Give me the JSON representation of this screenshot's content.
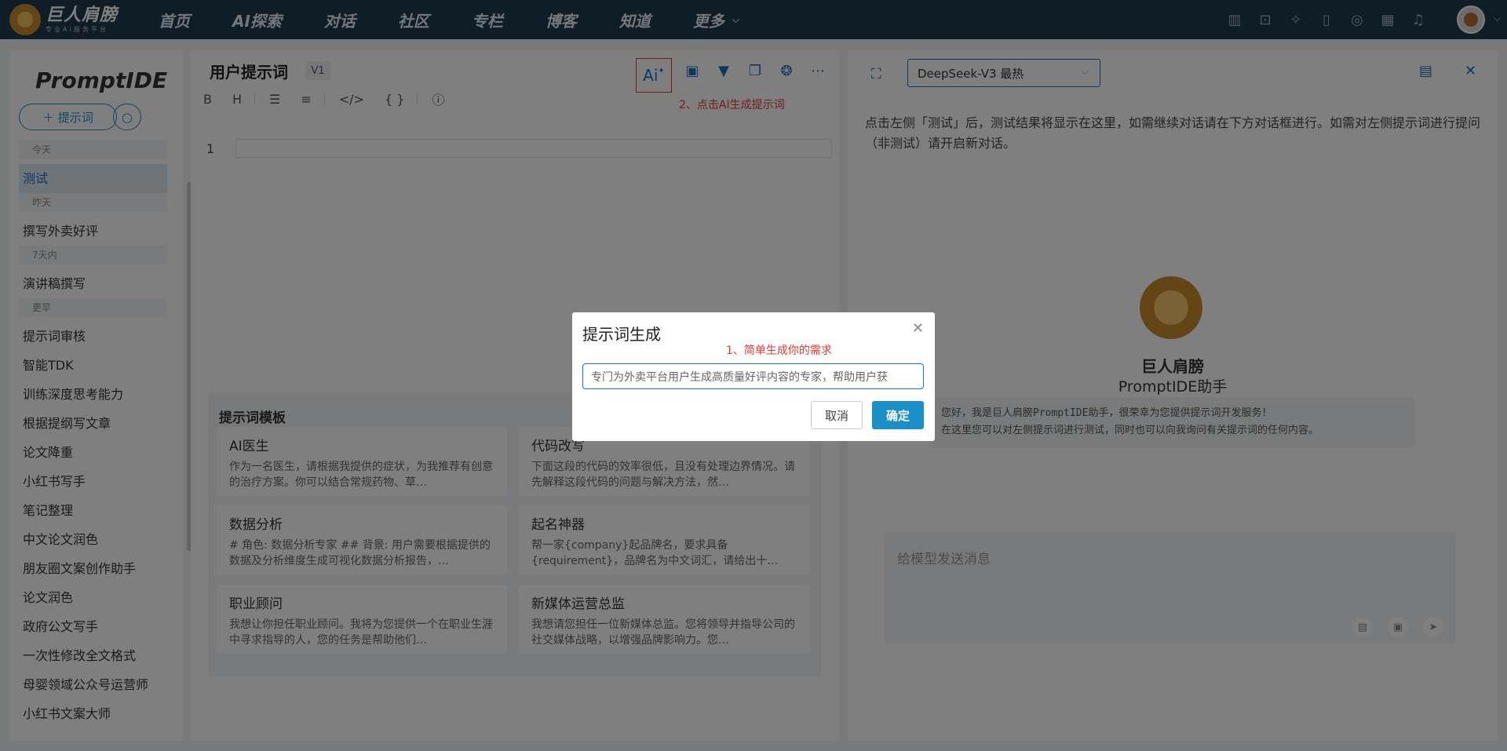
{
  "nav": {
    "logo_name": "巨人肩膀",
    "logo_sub": "专业AI服务平台",
    "items": [
      "首页",
      "AI探索",
      "对话",
      "社区",
      "专栏",
      "博客",
      "知道",
      "更多"
    ],
    "icons": [
      "chart-icon",
      "robot-icon",
      "magic-wand-icon",
      "book-icon",
      "disc-icon",
      "calendar-icon",
      "bell-icon"
    ]
  },
  "sidebar": {
    "brand": "PromptIDE",
    "new_prompt_label": "提示词",
    "groups": [
      {
        "label": "今天",
        "items": [
          "测试"
        ]
      },
      {
        "label": "昨天",
        "items": [
          "撰写外卖好评"
        ]
      },
      {
        "label": "7天内",
        "items": [
          "演讲稿撰写"
        ]
      },
      {
        "label": "更早",
        "items": [
          "提示词审核",
          "智能TDK",
          "训练深度思考能力",
          "根据提纲写文章",
          "论文降重",
          "小红书写手",
          "笔记整理",
          "中文论文润色",
          "朋友圈文案创作助手",
          "论文润色",
          "政府公文写手",
          "一次性修改全文格式",
          "母婴领域公众号运营师",
          "小红书文案大师"
        ]
      }
    ]
  },
  "editor": {
    "title": "用户提示词",
    "version": "V1",
    "ai_button": "Ai",
    "hint2": "2、点击AI生成提示词",
    "format_tools": [
      "B",
      "H"
    ],
    "line_number": "1",
    "template_heading": "提示词模板",
    "templates": [
      {
        "title": "AI医生",
        "desc": "作为一名医生，请根据我提供的症状，为我推荐有创意的治疗方案。你可以结合常规药物、草…"
      },
      {
        "title": "代码改写",
        "desc": "下面这段的代码的效率很低，且没有处理边界情况。请先解释这段代码的问题与解决方法，然…"
      },
      {
        "title": "数据分析",
        "desc": "# 角色: 数据分析专家 ## 背景: 用户需要根据提供的数据及分析维度生成可视化数据分析报告，…"
      },
      {
        "title": "起名神器",
        "desc": "帮一家{company}起品牌名，要求具备{requirement}，品牌名为中文词汇，请给出十…"
      },
      {
        "title": "职业顾问",
        "desc": "我想让你担任职业顾问。我将为您提供一个在职业生涯中寻求指导的人，您的任务是帮助他们…"
      },
      {
        "title": "新媒体运营总监",
        "desc": "我想请您担任一位新媒体总监。您将领导并指导公司的社交媒体战略，以增强品牌影响力。您…"
      }
    ]
  },
  "right": {
    "model": "DeepSeek-V3 最热",
    "description": "点击左侧「测试」后，测试结果将显示在这里，如需继续对话请在下方对话框进行。如需对左侧提示词进行提问（非测试）请开启新对话。",
    "bot_name": "巨人肩膀",
    "bot_sub": "PromptIDE助手",
    "welcome_line1": "您好，我是巨人肩膀PromptIDE助手，很荣幸为您提供提示词开发服务！",
    "welcome_line2": "在这里您可以对左侧提示词进行测试，同时也可以向我询问有关提示词的任何内容。",
    "chat_placeholder": "给模型发送消息"
  },
  "modal": {
    "title": "提示词生成",
    "hint1": "1、简单生成你的需求",
    "input_value": "专门为外卖平台用户生成高质量好评内容的专家，帮助用户获",
    "cancel_label": "取消",
    "ok_label": "确定"
  },
  "colors": {
    "topbar": "#1f3a4d",
    "accent": "#1a90c8",
    "hint_red": "#e53935"
  }
}
